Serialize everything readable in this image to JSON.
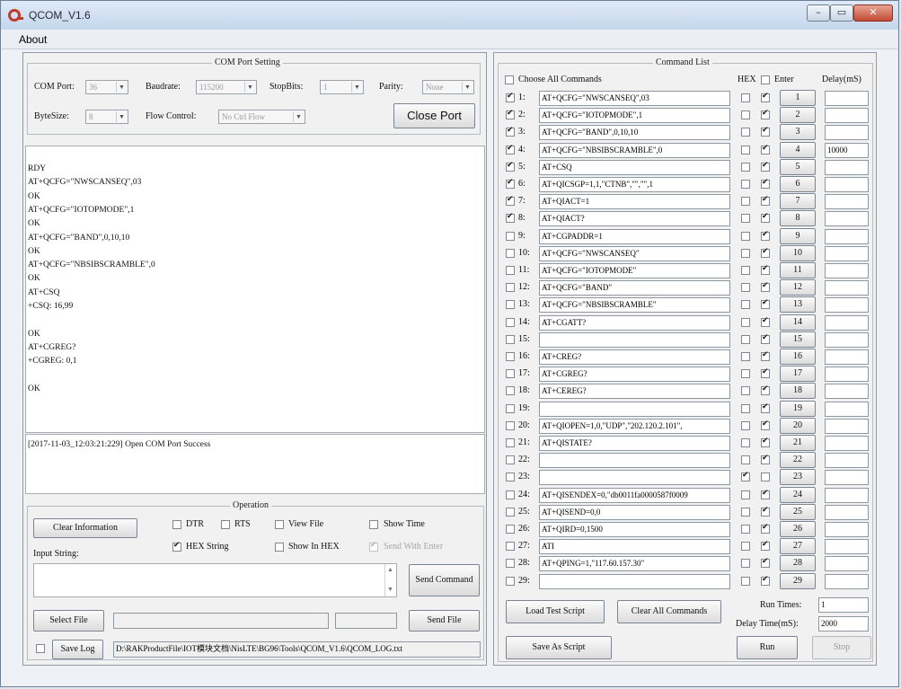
{
  "window": {
    "title": "QCOM_V1.6",
    "menu_about": "About"
  },
  "com_port": {
    "group_title": "COM Port Setting",
    "com_port_label": "COM Port:",
    "com_port_value": "36",
    "baudrate_label": "Baudrate:",
    "baudrate_value": "115200",
    "stopbits_label": "StopBits:",
    "stopbits_value": "1",
    "parity_label": "Parity:",
    "parity_value": "None",
    "bytesize_label": "ByteSize:",
    "bytesize_value": "8",
    "flow_label": "Flow Control:",
    "flow_value": "No Ctrl Flow",
    "close_port_label": "Close Port"
  },
  "terminal": {
    "lines": [
      "RDY",
      "AT+QCFG=\"NWSCANSEQ\",03",
      "OK",
      "AT+QCFG=\"IOTOPMODE\",1",
      "OK",
      "AT+QCFG=\"BAND\",0,10,10",
      "OK",
      "AT+QCFG=\"NBSIBSCRAMBLE\",0",
      "OK",
      "AT+CSQ",
      "+CSQ: 16,99",
      "",
      "OK",
      "AT+CGREG?",
      "+CGREG: 0,1",
      "",
      "OK"
    ]
  },
  "log": {
    "text": "[2017-11-03_12:03:21:229] Open COM Port Success"
  },
  "operation": {
    "group_title": "Operation",
    "clear_info_label": "Clear Information",
    "dtr_label": "DTR",
    "rts_label": "RTS",
    "view_file_label": "View File",
    "show_time_label": "Show Time",
    "hex_string_label": "HEX String",
    "show_in_hex_label": "Show In HEX",
    "send_with_enter_label": "Send With Enter",
    "input_string_label": "Input String:",
    "send_command_label": "Send Command",
    "select_file_label": "Select File",
    "send_file_label": "Send File",
    "save_log_label": "Save Log",
    "log_path": "D:\\RAKProductFile\\IOT模块文档\\NisLTE\\BG96\\Tools\\QCOM_V1.6\\QCOM_LOG.txt"
  },
  "command_list": {
    "group_title": "Command List",
    "choose_all_label": "Choose All Commands",
    "hex_header": "HEX",
    "enter_header": "Enter",
    "delay_header": "Delay(mS)",
    "rows": [
      {
        "num": "1:",
        "checked": true,
        "cmd": "AT+QCFG=\"NWSCANSEQ\",03",
        "hex": false,
        "enter": true,
        "btn": "1",
        "delay": ""
      },
      {
        "num": "2:",
        "checked": true,
        "cmd": "AT+QCFG=\"IOTOPMODE\",1",
        "hex": false,
        "enter": true,
        "btn": "2",
        "delay": ""
      },
      {
        "num": "3:",
        "checked": true,
        "cmd": "AT+QCFG=\"BAND\",0,10,10",
        "hex": false,
        "enter": true,
        "btn": "3",
        "delay": ""
      },
      {
        "num": "4:",
        "checked": true,
        "cmd": "AT+QCFG=\"NBSIBSCRAMBLE\",0",
        "hex": false,
        "enter": true,
        "btn": "4",
        "delay": "10000"
      },
      {
        "num": "5:",
        "checked": true,
        "cmd": "AT+CSQ",
        "hex": false,
        "enter": true,
        "btn": "5",
        "delay": ""
      },
      {
        "num": "6:",
        "checked": true,
        "cmd": "AT+QICSGP=1,1,\"CTNB\",\"\",\"\",1",
        "hex": false,
        "enter": true,
        "btn": "6",
        "delay": ""
      },
      {
        "num": "7:",
        "checked": true,
        "cmd": "AT+QIACT=1",
        "hex": false,
        "enter": true,
        "btn": "7",
        "delay": ""
      },
      {
        "num": "8:",
        "checked": true,
        "cmd": "AT+QIACT?",
        "hex": false,
        "enter": true,
        "btn": "8",
        "delay": ""
      },
      {
        "num": "9:",
        "checked": false,
        "cmd": "AT+CGPADDR=1",
        "hex": false,
        "enter": true,
        "btn": "9",
        "delay": ""
      },
      {
        "num": "10:",
        "checked": false,
        "cmd": "AT+QCFG=\"NWSCANSEQ\"",
        "hex": false,
        "enter": true,
        "btn": "10",
        "delay": ""
      },
      {
        "num": "11:",
        "checked": false,
        "cmd": "AT+QCFG=\"IOTOPMODE\"",
        "hex": false,
        "enter": true,
        "btn": "11",
        "delay": ""
      },
      {
        "num": "12:",
        "checked": false,
        "cmd": "AT+QCFG=\"BAND\"",
        "hex": false,
        "enter": true,
        "btn": "12",
        "delay": ""
      },
      {
        "num": "13:",
        "checked": false,
        "cmd": "AT+QCFG=\"NBSIBSCRAMBLE\"",
        "hex": false,
        "enter": true,
        "btn": "13",
        "delay": ""
      },
      {
        "num": "14:",
        "checked": false,
        "cmd": "AT+CGATT?",
        "hex": false,
        "enter": true,
        "btn": "14",
        "delay": ""
      },
      {
        "num": "15:",
        "checked": false,
        "cmd": "",
        "hex": false,
        "enter": true,
        "btn": "15",
        "delay": ""
      },
      {
        "num": "16:",
        "checked": false,
        "cmd": "AT+CREG?",
        "hex": false,
        "enter": true,
        "btn": "16",
        "delay": ""
      },
      {
        "num": "17:",
        "checked": false,
        "cmd": "AT+CGREG?",
        "hex": false,
        "enter": true,
        "btn": "17",
        "delay": ""
      },
      {
        "num": "18:",
        "checked": false,
        "cmd": "AT+CEREG?",
        "hex": false,
        "enter": true,
        "btn": "18",
        "delay": ""
      },
      {
        "num": "19:",
        "checked": false,
        "cmd": "",
        "hex": false,
        "enter": true,
        "btn": "19",
        "delay": ""
      },
      {
        "num": "20:",
        "checked": false,
        "cmd": "AT+QIOPEN=1,0,\"UDP\",\"202.120.2.101\",",
        "hex": false,
        "enter": true,
        "btn": "20",
        "delay": ""
      },
      {
        "num": "21:",
        "checked": false,
        "cmd": "AT+QISTATE?",
        "hex": false,
        "enter": true,
        "btn": "21",
        "delay": ""
      },
      {
        "num": "22:",
        "checked": false,
        "cmd": "",
        "hex": false,
        "enter": true,
        "btn": "22",
        "delay": ""
      },
      {
        "num": "23:",
        "checked": false,
        "cmd": "",
        "hex": true,
        "enter": false,
        "btn": "23",
        "delay": ""
      },
      {
        "num": "24:",
        "checked": false,
        "cmd": "AT+QISENDEX=0,\"db0011fa0000587f0009",
        "hex": false,
        "enter": true,
        "btn": "24",
        "delay": ""
      },
      {
        "num": "25:",
        "checked": false,
        "cmd": "AT+QISEND=0,0",
        "hex": false,
        "enter": true,
        "btn": "25",
        "delay": ""
      },
      {
        "num": "26:",
        "checked": false,
        "cmd": "AT+QIRD=0,1500",
        "hex": false,
        "enter": true,
        "btn": "26",
        "delay": ""
      },
      {
        "num": "27:",
        "checked": false,
        "cmd": "ATI",
        "hex": false,
        "enter": true,
        "btn": "27",
        "delay": ""
      },
      {
        "num": "28:",
        "checked": false,
        "cmd": "AT+QPING=1,\"117.60.157.30\"",
        "hex": false,
        "enter": true,
        "btn": "28",
        "delay": ""
      },
      {
        "num": "29:",
        "checked": false,
        "cmd": "",
        "hex": false,
        "enter": true,
        "btn": "29",
        "delay": ""
      }
    ],
    "load_script_label": "Load Test Script",
    "clear_all_label": "Clear All Commands",
    "save_script_label": "Save As Script",
    "run_times_label": "Run Times:",
    "run_times_value": "1",
    "delay_time_label": "Delay Time(mS):",
    "delay_time_value": "2000",
    "run_label": "Run",
    "stop_label": "Stop"
  }
}
